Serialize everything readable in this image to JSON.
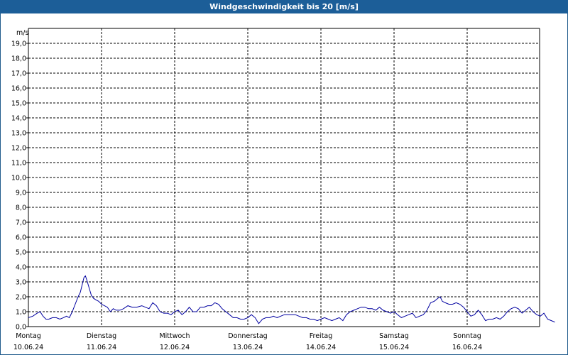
{
  "chart_data": {
    "type": "line",
    "title": "Windgeschwindigkeit bis 20 [m/s]",
    "ylabel": "m/s",
    "ylim": [
      0,
      20
    ],
    "yticks": [
      "0,0",
      "1,0",
      "2,0",
      "3,0",
      "4,0",
      "5,0",
      "6,0",
      "7,0",
      "8,0",
      "9,0",
      "10,0",
      "11,0",
      "12,0",
      "13,0",
      "14,0",
      "15,0",
      "16,0",
      "17,0",
      "18,0",
      "19,0"
    ],
    "xlim": [
      0,
      7
    ],
    "x_day_labels": [
      {
        "day": "Montag",
        "date": "10.06.24"
      },
      {
        "day": "Dienstag",
        "date": "11.06.24"
      },
      {
        "day": "Mittwoch",
        "date": "12.06.24"
      },
      {
        "day": "Donnerstag",
        "date": "13.06.24"
      },
      {
        "day": "Freitag",
        "date": "14.06.24"
      },
      {
        "day": "Samstag",
        "date": "15.06.24"
      },
      {
        "day": "Sonntag",
        "date": "16.06.24"
      }
    ],
    "grid": true,
    "series": [
      {
        "color": "#0000a0",
        "points": [
          [
            0.0,
            0.6
          ],
          [
            0.06,
            0.7
          ],
          [
            0.12,
            0.9
          ],
          [
            0.16,
            1.0
          ],
          [
            0.2,
            0.7
          ],
          [
            0.24,
            0.5
          ],
          [
            0.28,
            0.5
          ],
          [
            0.33,
            0.6
          ],
          [
            0.38,
            0.6
          ],
          [
            0.43,
            0.5
          ],
          [
            0.48,
            0.6
          ],
          [
            0.52,
            0.7
          ],
          [
            0.56,
            0.6
          ],
          [
            0.6,
            1.0
          ],
          [
            0.64,
            1.5
          ],
          [
            0.68,
            2.0
          ],
          [
            0.71,
            2.3
          ],
          [
            0.74,
            2.9
          ],
          [
            0.76,
            3.3
          ],
          [
            0.78,
            3.4
          ],
          [
            0.8,
            3.1
          ],
          [
            0.83,
            2.6
          ],
          [
            0.86,
            2.1
          ],
          [
            0.89,
            1.9
          ],
          [
            0.92,
            1.8
          ],
          [
            0.96,
            1.7
          ],
          [
            1.0,
            1.5
          ],
          [
            1.04,
            1.4
          ],
          [
            1.08,
            1.3
          ],
          [
            1.12,
            1.0
          ],
          [
            1.16,
            1.2
          ],
          [
            1.2,
            1.1
          ],
          [
            1.25,
            1.1
          ],
          [
            1.3,
            1.2
          ],
          [
            1.36,
            1.4
          ],
          [
            1.42,
            1.3
          ],
          [
            1.48,
            1.3
          ],
          [
            1.55,
            1.4
          ],
          [
            1.6,
            1.3
          ],
          [
            1.65,
            1.2
          ],
          [
            1.7,
            1.6
          ],
          [
            1.75,
            1.4
          ],
          [
            1.8,
            1.0
          ],
          [
            1.85,
            0.9
          ],
          [
            1.9,
            0.9
          ],
          [
            1.95,
            0.8
          ],
          [
            2.0,
            1.0
          ],
          [
            2.05,
            1.1
          ],
          [
            2.1,
            0.8
          ],
          [
            2.15,
            1.0
          ],
          [
            2.2,
            1.3
          ],
          [
            2.25,
            1.0
          ],
          [
            2.3,
            1.0
          ],
          [
            2.35,
            1.3
          ],
          [
            2.4,
            1.3
          ],
          [
            2.45,
            1.4
          ],
          [
            2.5,
            1.4
          ],
          [
            2.55,
            1.6
          ],
          [
            2.6,
            1.5
          ],
          [
            2.65,
            1.2
          ],
          [
            2.7,
            1.0
          ],
          [
            2.75,
            0.8
          ],
          [
            2.8,
            0.6
          ],
          [
            2.85,
            0.6
          ],
          [
            2.9,
            0.5
          ],
          [
            2.95,
            0.5
          ],
          [
            3.0,
            0.6
          ],
          [
            3.05,
            0.8
          ],
          [
            3.1,
            0.6
          ],
          [
            3.15,
            0.2
          ],
          [
            3.2,
            0.5
          ],
          [
            3.25,
            0.6
          ],
          [
            3.3,
            0.6
          ],
          [
            3.35,
            0.7
          ],
          [
            3.4,
            0.6
          ],
          [
            3.45,
            0.7
          ],
          [
            3.5,
            0.8
          ],
          [
            3.55,
            0.8
          ],
          [
            3.6,
            0.8
          ],
          [
            3.65,
            0.8
          ],
          [
            3.7,
            0.7
          ],
          [
            3.75,
            0.6
          ],
          [
            3.8,
            0.6
          ],
          [
            3.85,
            0.5
          ],
          [
            3.9,
            0.5
          ],
          [
            3.95,
            0.4
          ],
          [
            4.0,
            0.5
          ],
          [
            4.05,
            0.6
          ],
          [
            4.1,
            0.5
          ],
          [
            4.15,
            0.4
          ],
          [
            4.2,
            0.5
          ],
          [
            4.25,
            0.6
          ],
          [
            4.3,
            0.4
          ],
          [
            4.35,
            0.8
          ],
          [
            4.4,
            1.0
          ],
          [
            4.45,
            1.1
          ],
          [
            4.5,
            1.2
          ],
          [
            4.55,
            1.3
          ],
          [
            4.6,
            1.3
          ],
          [
            4.65,
            1.2
          ],
          [
            4.7,
            1.2
          ],
          [
            4.75,
            1.1
          ],
          [
            4.8,
            1.3
          ],
          [
            4.85,
            1.1
          ],
          [
            4.9,
            1.0
          ],
          [
            4.95,
            0.9
          ],
          [
            5.0,
            1.0
          ],
          [
            5.05,
            0.8
          ],
          [
            5.1,
            0.6
          ],
          [
            5.15,
            0.7
          ],
          [
            5.2,
            0.8
          ],
          [
            5.25,
            0.9
          ],
          [
            5.3,
            0.6
          ],
          [
            5.35,
            0.7
          ],
          [
            5.4,
            0.8
          ],
          [
            5.45,
            1.1
          ],
          [
            5.5,
            1.6
          ],
          [
            5.55,
            1.7
          ],
          [
            5.6,
            1.9
          ],
          [
            5.63,
            2.0
          ],
          [
            5.66,
            1.7
          ],
          [
            5.7,
            1.6
          ],
          [
            5.75,
            1.5
          ],
          [
            5.8,
            1.5
          ],
          [
            5.85,
            1.6
          ],
          [
            5.9,
            1.5
          ],
          [
            5.95,
            1.3
          ],
          [
            6.0,
            1.0
          ],
          [
            6.05,
            0.7
          ],
          [
            6.1,
            0.8
          ],
          [
            6.15,
            1.1
          ],
          [
            6.2,
            0.8
          ],
          [
            6.25,
            0.4
          ],
          [
            6.3,
            0.5
          ],
          [
            6.35,
            0.5
          ],
          [
            6.4,
            0.6
          ],
          [
            6.45,
            0.5
          ],
          [
            6.5,
            0.7
          ],
          [
            6.55,
            1.0
          ],
          [
            6.6,
            1.2
          ],
          [
            6.65,
            1.3
          ],
          [
            6.7,
            1.2
          ],
          [
            6.75,
            0.9
          ],
          [
            6.8,
            1.1
          ],
          [
            6.85,
            1.3
          ],
          [
            6.9,
            1.0
          ],
          [
            6.95,
            0.8
          ],
          [
            7.0,
            0.7
          ],
          [
            7.05,
            0.9
          ],
          [
            7.1,
            0.5
          ],
          [
            7.15,
            0.4
          ],
          [
            7.2,
            0.3
          ]
        ]
      }
    ]
  }
}
